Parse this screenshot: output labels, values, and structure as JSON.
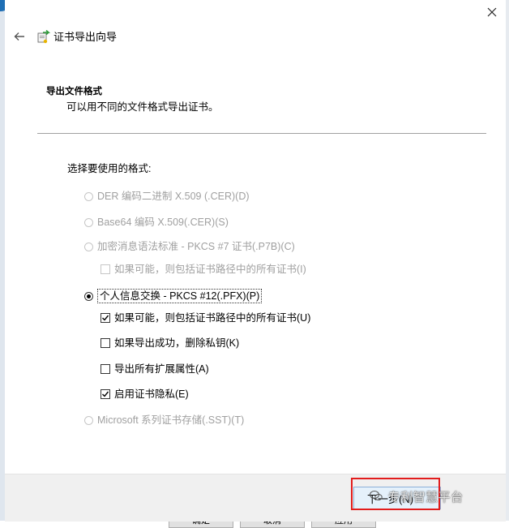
{
  "background": {
    "buttons": [
      "确定",
      "取消",
      "应用"
    ]
  },
  "window": {
    "close_icon": "close-icon",
    "back_icon": "back-arrow-icon",
    "title_icon": "certificate-export-icon",
    "title": "证书导出向导"
  },
  "section": {
    "heading": "导出文件格式",
    "description": "可以用不同的文件格式导出证书。"
  },
  "formats": {
    "label": "选择要使用的格式:",
    "options": [
      {
        "label": "DER 编码二进制 X.509 (.CER)(D)",
        "enabled": false,
        "selected": false
      },
      {
        "label": "Base64 编码 X.509(.CER)(S)",
        "enabled": false,
        "selected": false
      },
      {
        "label": "加密消息语法标准 - PKCS #7 证书(.P7B)(C)",
        "enabled": false,
        "selected": false
      },
      {
        "label": "个人信息交换 - PKCS #12(.PFX)(P)",
        "enabled": true,
        "selected": true
      },
      {
        "label": "Microsoft 系列证书存储(.SST)(T)",
        "enabled": false,
        "selected": false
      }
    ],
    "p7b_suboptions": [
      {
        "label": "如果可能，则包括证书路径中的所有证书(I)",
        "checked": false,
        "enabled": false
      }
    ],
    "pfx_suboptions": [
      {
        "label": "如果可能，则包括证书路径中的所有证书(U)",
        "checked": true,
        "enabled": true
      },
      {
        "label": "如果导出成功，删除私钥(K)",
        "checked": false,
        "enabled": true
      },
      {
        "label": "导出所有扩展属性(A)",
        "checked": false,
        "enabled": true
      },
      {
        "label": "启用证书隐私(E)",
        "checked": true,
        "enabled": true
      }
    ]
  },
  "footer": {
    "next_label": "下一步(N)",
    "watermark": "专利智慧平台"
  },
  "colors": {
    "highlight": "#e21d1d",
    "disabled_text": "#a0a0a0"
  }
}
